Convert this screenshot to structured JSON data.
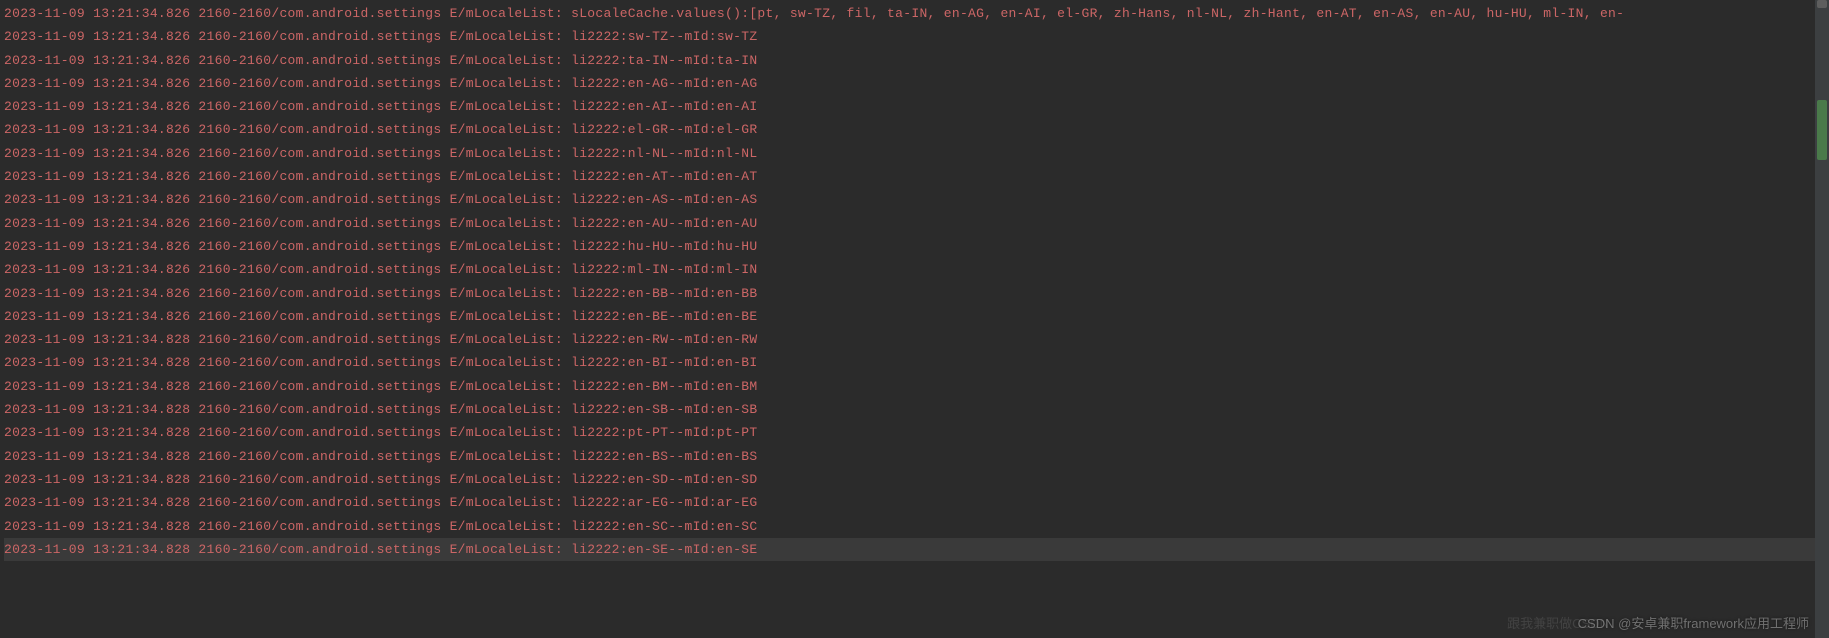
{
  "log": {
    "lines": [
      {
        "ts": "2023-11-09 13:21:34.826",
        "pid": "2160-2160",
        "pkg": "com.android.settings",
        "lvl": "E",
        "tag": "mLocaleList",
        "msg": "sLocaleCache.values():[pt, sw-TZ, fil, ta-IN, en-AG, en-AI, el-GR, zh-Hans, nl-NL, zh-Hant, en-AT, en-AS, en-AU, hu-HU, ml-IN, en-"
      },
      {
        "ts": "2023-11-09 13:21:34.826",
        "pid": "2160-2160",
        "pkg": "com.android.settings",
        "lvl": "E",
        "tag": "mLocaleList",
        "msg": "li2222:sw-TZ--mId:sw-TZ"
      },
      {
        "ts": "2023-11-09 13:21:34.826",
        "pid": "2160-2160",
        "pkg": "com.android.settings",
        "lvl": "E",
        "tag": "mLocaleList",
        "msg": "li2222:ta-IN--mId:ta-IN"
      },
      {
        "ts": "2023-11-09 13:21:34.826",
        "pid": "2160-2160",
        "pkg": "com.android.settings",
        "lvl": "E",
        "tag": "mLocaleList",
        "msg": "li2222:en-AG--mId:en-AG"
      },
      {
        "ts": "2023-11-09 13:21:34.826",
        "pid": "2160-2160",
        "pkg": "com.android.settings",
        "lvl": "E",
        "tag": "mLocaleList",
        "msg": "li2222:en-AI--mId:en-AI"
      },
      {
        "ts": "2023-11-09 13:21:34.826",
        "pid": "2160-2160",
        "pkg": "com.android.settings",
        "lvl": "E",
        "tag": "mLocaleList",
        "msg": "li2222:el-GR--mId:el-GR"
      },
      {
        "ts": "2023-11-09 13:21:34.826",
        "pid": "2160-2160",
        "pkg": "com.android.settings",
        "lvl": "E",
        "tag": "mLocaleList",
        "msg": "li2222:nl-NL--mId:nl-NL"
      },
      {
        "ts": "2023-11-09 13:21:34.826",
        "pid": "2160-2160",
        "pkg": "com.android.settings",
        "lvl": "E",
        "tag": "mLocaleList",
        "msg": "li2222:en-AT--mId:en-AT"
      },
      {
        "ts": "2023-11-09 13:21:34.826",
        "pid": "2160-2160",
        "pkg": "com.android.settings",
        "lvl": "E",
        "tag": "mLocaleList",
        "msg": "li2222:en-AS--mId:en-AS"
      },
      {
        "ts": "2023-11-09 13:21:34.826",
        "pid": "2160-2160",
        "pkg": "com.android.settings",
        "lvl": "E",
        "tag": "mLocaleList",
        "msg": "li2222:en-AU--mId:en-AU"
      },
      {
        "ts": "2023-11-09 13:21:34.826",
        "pid": "2160-2160",
        "pkg": "com.android.settings",
        "lvl": "E",
        "tag": "mLocaleList",
        "msg": "li2222:hu-HU--mId:hu-HU"
      },
      {
        "ts": "2023-11-09 13:21:34.826",
        "pid": "2160-2160",
        "pkg": "com.android.settings",
        "lvl": "E",
        "tag": "mLocaleList",
        "msg": "li2222:ml-IN--mId:ml-IN"
      },
      {
        "ts": "2023-11-09 13:21:34.826",
        "pid": "2160-2160",
        "pkg": "com.android.settings",
        "lvl": "E",
        "tag": "mLocaleList",
        "msg": "li2222:en-BB--mId:en-BB"
      },
      {
        "ts": "2023-11-09 13:21:34.826",
        "pid": "2160-2160",
        "pkg": "com.android.settings",
        "lvl": "E",
        "tag": "mLocaleList",
        "msg": "li2222:en-BE--mId:en-BE"
      },
      {
        "ts": "2023-11-09 13:21:34.828",
        "pid": "2160-2160",
        "pkg": "com.android.settings",
        "lvl": "E",
        "tag": "mLocaleList",
        "msg": "li2222:en-RW--mId:en-RW"
      },
      {
        "ts": "2023-11-09 13:21:34.828",
        "pid": "2160-2160",
        "pkg": "com.android.settings",
        "lvl": "E",
        "tag": "mLocaleList",
        "msg": "li2222:en-BI--mId:en-BI"
      },
      {
        "ts": "2023-11-09 13:21:34.828",
        "pid": "2160-2160",
        "pkg": "com.android.settings",
        "lvl": "E",
        "tag": "mLocaleList",
        "msg": "li2222:en-BM--mId:en-BM"
      },
      {
        "ts": "2023-11-09 13:21:34.828",
        "pid": "2160-2160",
        "pkg": "com.android.settings",
        "lvl": "E",
        "tag": "mLocaleList",
        "msg": "li2222:en-SB--mId:en-SB"
      },
      {
        "ts": "2023-11-09 13:21:34.828",
        "pid": "2160-2160",
        "pkg": "com.android.settings",
        "lvl": "E",
        "tag": "mLocaleList",
        "msg": "li2222:pt-PT--mId:pt-PT"
      },
      {
        "ts": "2023-11-09 13:21:34.828",
        "pid": "2160-2160",
        "pkg": "com.android.settings",
        "lvl": "E",
        "tag": "mLocaleList",
        "msg": "li2222:en-BS--mId:en-BS"
      },
      {
        "ts": "2023-11-09 13:21:34.828",
        "pid": "2160-2160",
        "pkg": "com.android.settings",
        "lvl": "E",
        "tag": "mLocaleList",
        "msg": "li2222:en-SD--mId:en-SD"
      },
      {
        "ts": "2023-11-09 13:21:34.828",
        "pid": "2160-2160",
        "pkg": "com.android.settings",
        "lvl": "E",
        "tag": "mLocaleList",
        "msg": "li2222:ar-EG--mId:ar-EG"
      },
      {
        "ts": "2023-11-09 13:21:34.828",
        "pid": "2160-2160",
        "pkg": "com.android.settings",
        "lvl": "E",
        "tag": "mLocaleList",
        "msg": "li2222:en-SC--mId:en-SC"
      },
      {
        "ts": "2023-11-09 13:21:34.828",
        "pid": "2160-2160",
        "pkg": "com.android.settings",
        "lvl": "E",
        "tag": "mLocaleList",
        "msg": "li2222:en-SE--mId:en-SE",
        "highlighted": true
      }
    ]
  },
  "watermark": {
    "text": "CSDN @安卓兼职framework应用工程师",
    "bgtext": "跟我兼职做CSDN"
  }
}
